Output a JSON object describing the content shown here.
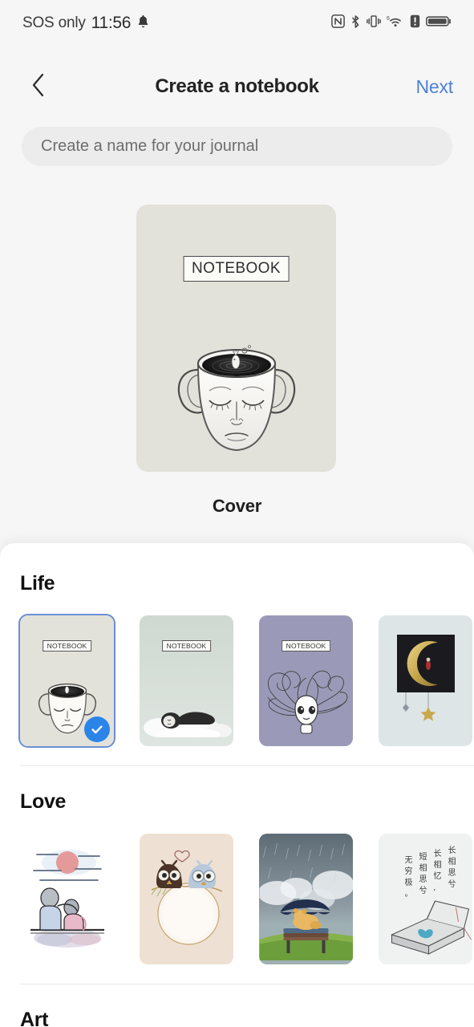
{
  "statusbar": {
    "carrier": "SOS only",
    "time": "11:56",
    "left_icons": [
      "bell-icon"
    ],
    "right_icons": [
      "nfc-icon",
      "bluetooth-icon",
      "vibrate-icon",
      "wifi6-icon",
      "alert-icon",
      "battery-icon"
    ]
  },
  "navbar": {
    "back_icon": "chevron-left-icon",
    "title": "Create a notebook",
    "next_label": "Next",
    "next_color": "#4e80d8"
  },
  "name_input": {
    "value": "",
    "placeholder": "Create a name for your journal"
  },
  "cover_preview": {
    "caption": "Cover",
    "label": "NOTEBOOK",
    "background": "#e3e2da",
    "art": "face-cup-with-fish-illustration"
  },
  "sections": [
    {
      "title": "Life",
      "covers": [
        {
          "label": "NOTEBOOK",
          "background": "#e3e2da",
          "art": "face-cup-with-fish-illustration",
          "selected": true
        },
        {
          "label": "NOTEBOOK",
          "background": "#ccd6cc",
          "art": "baby-sleeping-on-clouds-illustration",
          "selected": false
        },
        {
          "label": "NOTEBOOK",
          "background": "#9a9ab8",
          "art": "girl-with-flowing-hair-illustration",
          "selected": false
        },
        {
          "label": "",
          "background": "#dde5e7",
          "art": "crescent-moon-illustration",
          "selected": false
        }
      ]
    },
    {
      "title": "Love",
      "covers": [
        {
          "label": "",
          "background": "#ffffff",
          "art": "couple-watching-sunset-illustration",
          "selected": false
        },
        {
          "label": "",
          "background": "#efe2d4",
          "art": "two-owls-with-heart-illustration",
          "selected": false
        },
        {
          "label": "",
          "background": "#6f7d86",
          "art": "teddy-bear-on-bench-with-umbrella-illustration",
          "selected": false
        },
        {
          "label": "",
          "background": "#f0f1f1",
          "art": "chinese-poem-open-book-illustration",
          "selected": false
        }
      ]
    },
    {
      "title": "Art",
      "covers": []
    }
  ],
  "colors": {
    "accent_blue": "#2b84e8",
    "selection_border": "#6b8fd6",
    "page_background": "#f6f6f6",
    "sheet_background": "#ffffff",
    "input_background": "#ececec"
  }
}
